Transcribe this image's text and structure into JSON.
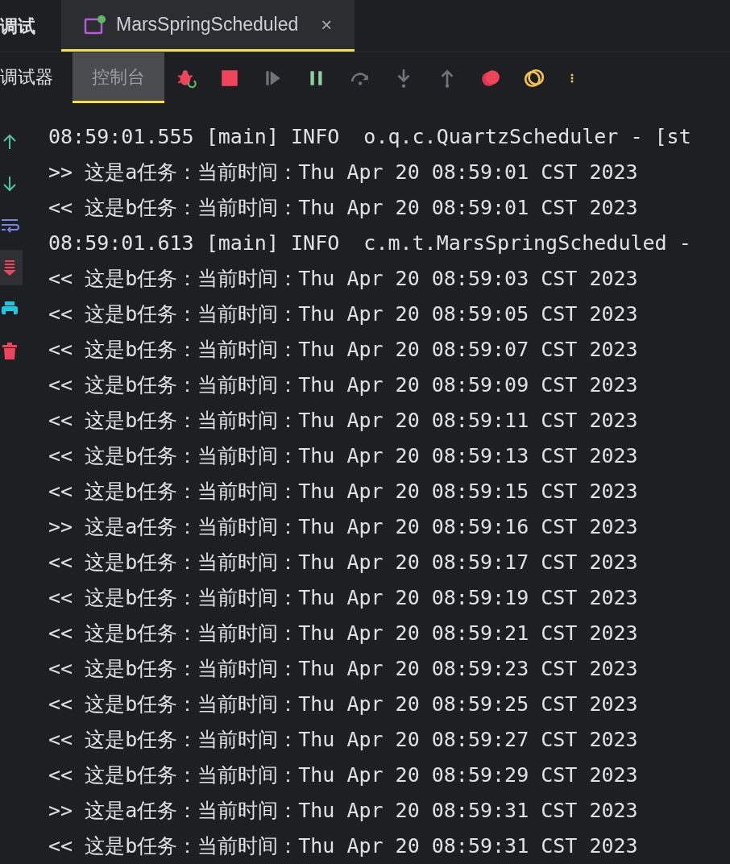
{
  "panel": {
    "title": "调试"
  },
  "tabs": [
    {
      "label": "MarsSpringScheduled",
      "selected": true,
      "running": true,
      "close": "×"
    }
  ],
  "subtabs": [
    {
      "label": "调试器",
      "selected": false
    },
    {
      "label": "控制台",
      "selected": true
    }
  ],
  "toolbar": [
    {
      "kind": "rerun",
      "disabled": false
    },
    {
      "kind": "stop",
      "disabled": false
    },
    {
      "kind": "resume",
      "disabled": true
    },
    {
      "kind": "pause",
      "disabled": false
    },
    {
      "kind": "stepover",
      "disabled": true
    },
    {
      "kind": "stepinto",
      "disabled": true
    },
    {
      "kind": "stepout",
      "disabled": true
    },
    {
      "kind": "breakpoints",
      "disabled": false
    },
    {
      "kind": "mute",
      "disabled": false
    },
    {
      "kind": "more",
      "disabled": false
    }
  ],
  "sidebar": [
    {
      "kind": "up",
      "selected": false
    },
    {
      "kind": "down",
      "selected": false
    },
    {
      "kind": "wrap",
      "selected": false
    },
    {
      "kind": "scroll",
      "selected": true
    },
    {
      "kind": "print",
      "selected": false
    },
    {
      "kind": "clear",
      "selected": false
    }
  ],
  "log": [
    "08:59:01.555 [main] INFO  o.q.c.QuartzScheduler - [st",
    ">> 这是a任务：当前时间：Thu Apr 20 08:59:01 CST 2023",
    "<< 这是b任务：当前时间：Thu Apr 20 08:59:01 CST 2023",
    "08:59:01.613 [main] INFO  c.m.t.MarsSpringScheduled -",
    "<< 这是b任务：当前时间：Thu Apr 20 08:59:03 CST 2023",
    "<< 这是b任务：当前时间：Thu Apr 20 08:59:05 CST 2023",
    "<< 这是b任务：当前时间：Thu Apr 20 08:59:07 CST 2023",
    "<< 这是b任务：当前时间：Thu Apr 20 08:59:09 CST 2023",
    "<< 这是b任务：当前时间：Thu Apr 20 08:59:11 CST 2023",
    "<< 这是b任务：当前时间：Thu Apr 20 08:59:13 CST 2023",
    "<< 这是b任务：当前时间：Thu Apr 20 08:59:15 CST 2023",
    ">> 这是a任务：当前时间：Thu Apr 20 08:59:16 CST 2023",
    "<< 这是b任务：当前时间：Thu Apr 20 08:59:17 CST 2023",
    "<< 这是b任务：当前时间：Thu Apr 20 08:59:19 CST 2023",
    "<< 这是b任务：当前时间：Thu Apr 20 08:59:21 CST 2023",
    "<< 这是b任务：当前时间：Thu Apr 20 08:59:23 CST 2023",
    "<< 这是b任务：当前时间：Thu Apr 20 08:59:25 CST 2023",
    "<< 这是b任务：当前时间：Thu Apr 20 08:59:27 CST 2023",
    "<< 这是b任务：当前时间：Thu Apr 20 08:59:29 CST 2023",
    ">> 这是a任务：当前时间：Thu Apr 20 08:59:31 CST 2023",
    "<< 这是b任务：当前时间：Thu Apr 20 08:59:31 CST 2023"
  ]
}
